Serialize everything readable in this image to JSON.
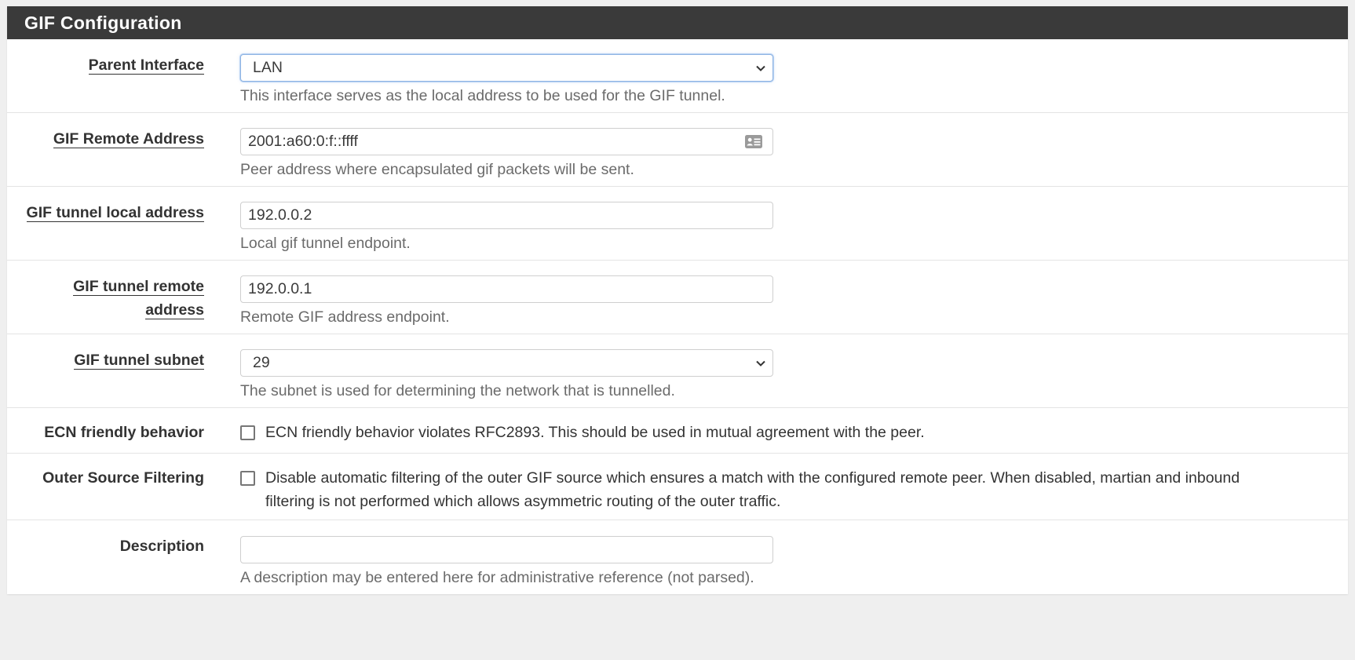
{
  "panel": {
    "title": "GIF Configuration"
  },
  "fields": {
    "parent_interface": {
      "label": "Parent Interface",
      "value": "LAN",
      "help": "This interface serves as the local address to be used for the GIF tunnel."
    },
    "remote_address": {
      "label": "GIF Remote Address",
      "value": "2001:a60:0:f::ffff",
      "icon": "contact-card-icon",
      "help": "Peer address where encapsulated gif packets will be sent."
    },
    "tunnel_local": {
      "label": "GIF tunnel local address",
      "value": "192.0.0.2",
      "help": "Local gif tunnel endpoint."
    },
    "tunnel_remote": {
      "label_line1": "GIF tunnel remote",
      "label_line2": "address",
      "value": "192.0.0.1",
      "help": "Remote GIF address endpoint."
    },
    "tunnel_subnet": {
      "label": "GIF tunnel subnet",
      "value": "29",
      "help": "The subnet is used for determining the network that is tunnelled."
    },
    "ecn": {
      "label": "ECN friendly behavior",
      "checked": false,
      "text": "ECN friendly behavior violates RFC2893. This should be used in mutual agreement with the peer."
    },
    "outer_source": {
      "label": "Outer Source Filtering",
      "checked": false,
      "text_line1": "Disable automatic filtering of the outer GIF source which ensures a match with the configured remote peer. When disabled, martian and inbound",
      "text_line2": "filtering is not performed which allows asymmetric routing of the outer traffic."
    },
    "description": {
      "label": "Description",
      "value": "",
      "help": "A description may be entered here for administrative reference (not parsed)."
    }
  },
  "colors": {
    "header_bg": "#3a3a3a",
    "focus_border": "#8fb4e3",
    "help_text": "#6b6b6b"
  }
}
